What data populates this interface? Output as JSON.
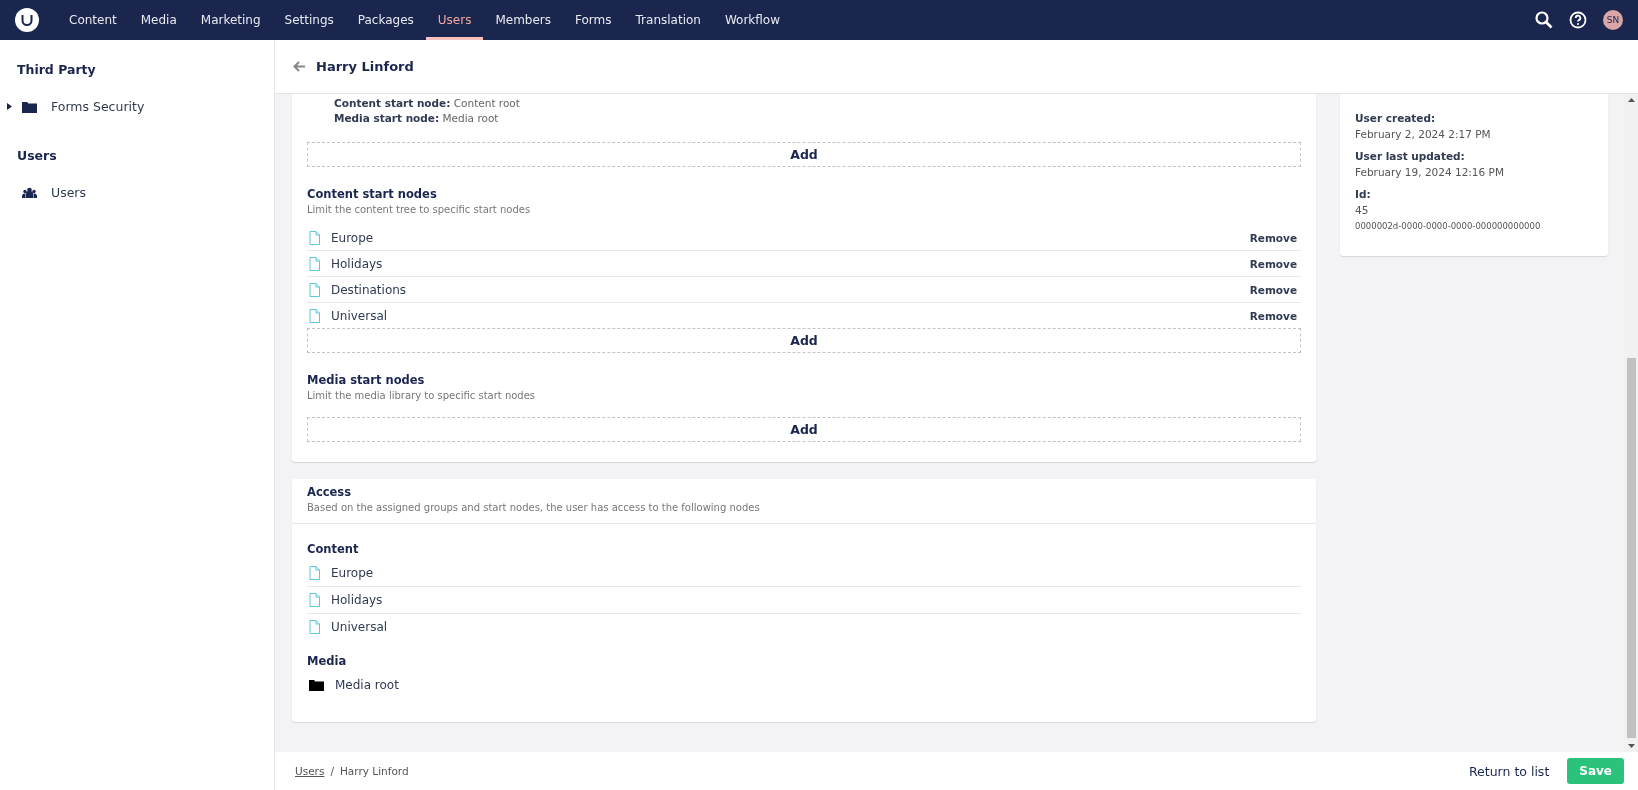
{
  "top_nav": {
    "items": [
      {
        "label": "Content",
        "selected": false
      },
      {
        "label": "Media",
        "selected": false
      },
      {
        "label": "Marketing",
        "selected": false
      },
      {
        "label": "Settings",
        "selected": false
      },
      {
        "label": "Packages",
        "selected": false
      },
      {
        "label": "Users",
        "selected": true
      },
      {
        "label": "Members",
        "selected": false
      },
      {
        "label": "Forms",
        "selected": false
      },
      {
        "label": "Translation",
        "selected": false
      },
      {
        "label": "Workflow",
        "selected": false
      }
    ],
    "avatar": "SN"
  },
  "sidebar": {
    "sections": [
      {
        "title": "Third Party",
        "items": [
          {
            "label": "Forms Security",
            "kind": "folder",
            "expandable": true
          }
        ]
      },
      {
        "title": "Users",
        "items": [
          {
            "label": "Users",
            "kind": "users",
            "expandable": false
          }
        ]
      }
    ]
  },
  "header": {
    "title": "Harry Linford"
  },
  "user_group": {
    "details": [
      {
        "label": "Content start node:",
        "value": "Content root"
      },
      {
        "label": "Media start node:",
        "value": "Media root"
      }
    ],
    "add_label": "Add"
  },
  "content_start_nodes": {
    "title": "Content start nodes",
    "description": "Limit the content tree to specific start nodes",
    "nodes": [
      {
        "name": "Europe",
        "action": "Remove"
      },
      {
        "name": "Holidays",
        "action": "Remove"
      },
      {
        "name": "Destinations",
        "action": "Remove"
      },
      {
        "name": "Universal",
        "action": "Remove"
      }
    ],
    "add_label": "Add"
  },
  "media_start_nodes": {
    "title": "Media start nodes",
    "description": "Limit the media library to specific start nodes",
    "add_label": "Add"
  },
  "access": {
    "title": "Access",
    "description": "Based on the assigned groups and start nodes, the user has access to the following nodes",
    "sections": [
      {
        "title": "Content",
        "kind": "document",
        "items": [
          "Europe",
          "Holidays",
          "Universal"
        ]
      },
      {
        "title": "Media",
        "kind": "folder",
        "items": [
          "Media root"
        ]
      }
    ]
  },
  "info_card": {
    "fields": [
      {
        "label": "User created:",
        "values": [
          "February 2, 2024 2:17 PM"
        ]
      },
      {
        "label": "User last updated:",
        "values": [
          "February 19, 2024 12:16 PM"
        ]
      },
      {
        "label": "Id:",
        "values": [
          "45",
          "0000002d-0000-0000-0000-000000000000"
        ]
      }
    ]
  },
  "breadcrumb": {
    "separator": "/",
    "items": [
      {
        "label": "Users",
        "link": true
      },
      {
        "label": "Harry Linford",
        "link": false
      }
    ]
  },
  "footer": {
    "return_label": "Return to list",
    "save_label": "Save"
  }
}
